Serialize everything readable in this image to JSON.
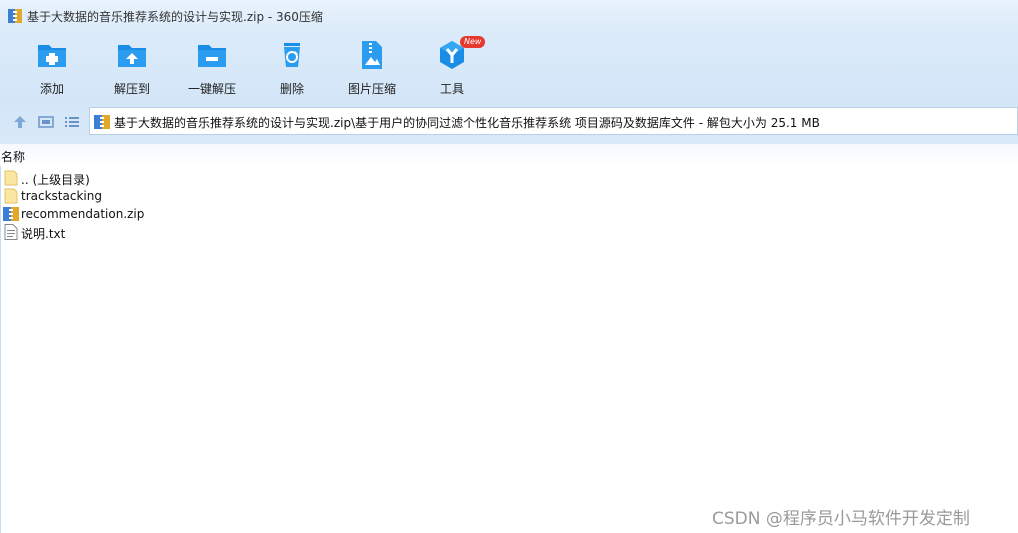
{
  "window": {
    "title": "基于大数据的音乐推荐系统的设计与实现.zip - 360压缩"
  },
  "toolbar": {
    "items": [
      {
        "label": "添加",
        "icon": "add-folder-icon"
      },
      {
        "label": "解压到",
        "icon": "extract-to-icon"
      },
      {
        "label": "一键解压",
        "icon": "one-click-extract-icon"
      },
      {
        "label": "删除",
        "icon": "recycle-delete-icon"
      },
      {
        "label": "图片压缩",
        "icon": "image-compress-icon"
      },
      {
        "label": "工具",
        "icon": "tools-icon",
        "badge": "New"
      }
    ]
  },
  "navigation": {
    "path": "基于大数据的音乐推荐系统的设计与实现.zip\\基于用户的协同过滤个性化音乐推荐系统 项目源码及数据库文件 - 解包大小为 25.1 MB"
  },
  "file_list": {
    "column_header": "名称",
    "items": [
      {
        "name": ".. (上级目录)",
        "type": "folder"
      },
      {
        "name": "trackstacking",
        "type": "folder"
      },
      {
        "name": "recommendation.zip",
        "type": "zip"
      },
      {
        "name": "说明.txt",
        "type": "text"
      }
    ]
  },
  "watermark": "CSDN @程序员小马软件开发定制",
  "colors": {
    "accent": "#1a8ee6",
    "toolbar_bg": "#d8e9f9",
    "badge": "#e8392f"
  }
}
